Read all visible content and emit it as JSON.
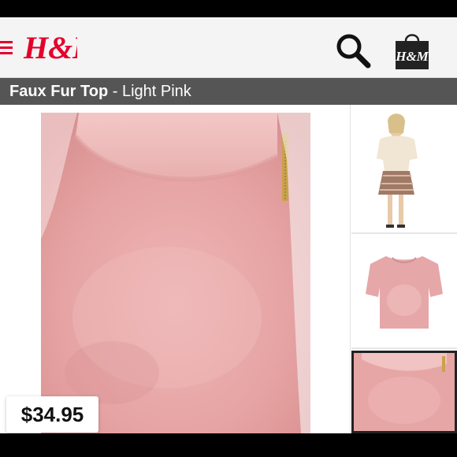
{
  "header": {
    "logo_text": "H&M",
    "bag_label": "H&M",
    "brand_color": "#e4002b"
  },
  "product": {
    "name": "Faux Fur Top",
    "separator": " - ",
    "color": "Light Pink",
    "price": "$34.95"
  },
  "icons": {
    "menu": "menu-icon",
    "search": "search-icon",
    "bag": "shopping-bag-icon"
  },
  "gallery": {
    "selected_index": 2,
    "thumbnail_count": 3
  }
}
